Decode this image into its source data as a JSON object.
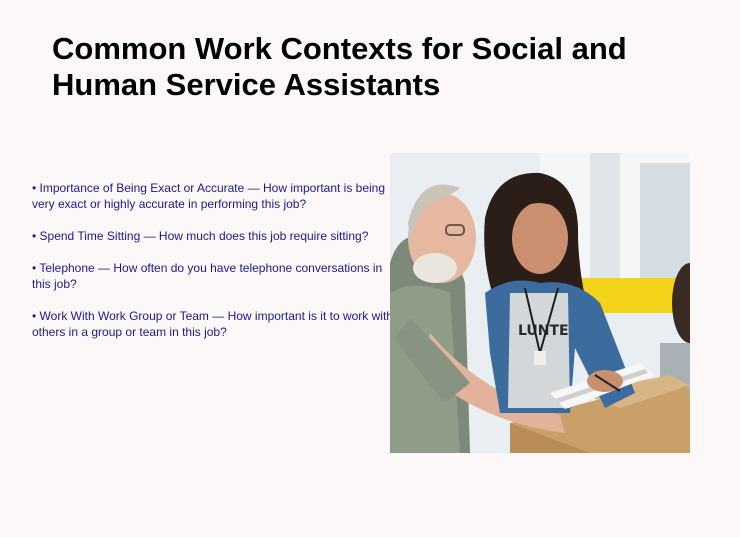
{
  "slide": {
    "title": "Common Work Contexts for Social and Human Service Assistants",
    "bullets": [
      "• Importance of Being Exact or Accurate — How important is being very exact or highly accurate in performing this job?",
      "• Spend Time Sitting — How much does this job require sitting?",
      "• Telephone — How often do you have telephone conversations in this job?",
      "• Work With Work Group or Team — How important is it to work with others in a group or team in this job?"
    ],
    "photo": {
      "shirt_text": "LUNTE",
      "subject": "older-man-and-young-woman-with-clipboard-packing-boxes"
    }
  }
}
